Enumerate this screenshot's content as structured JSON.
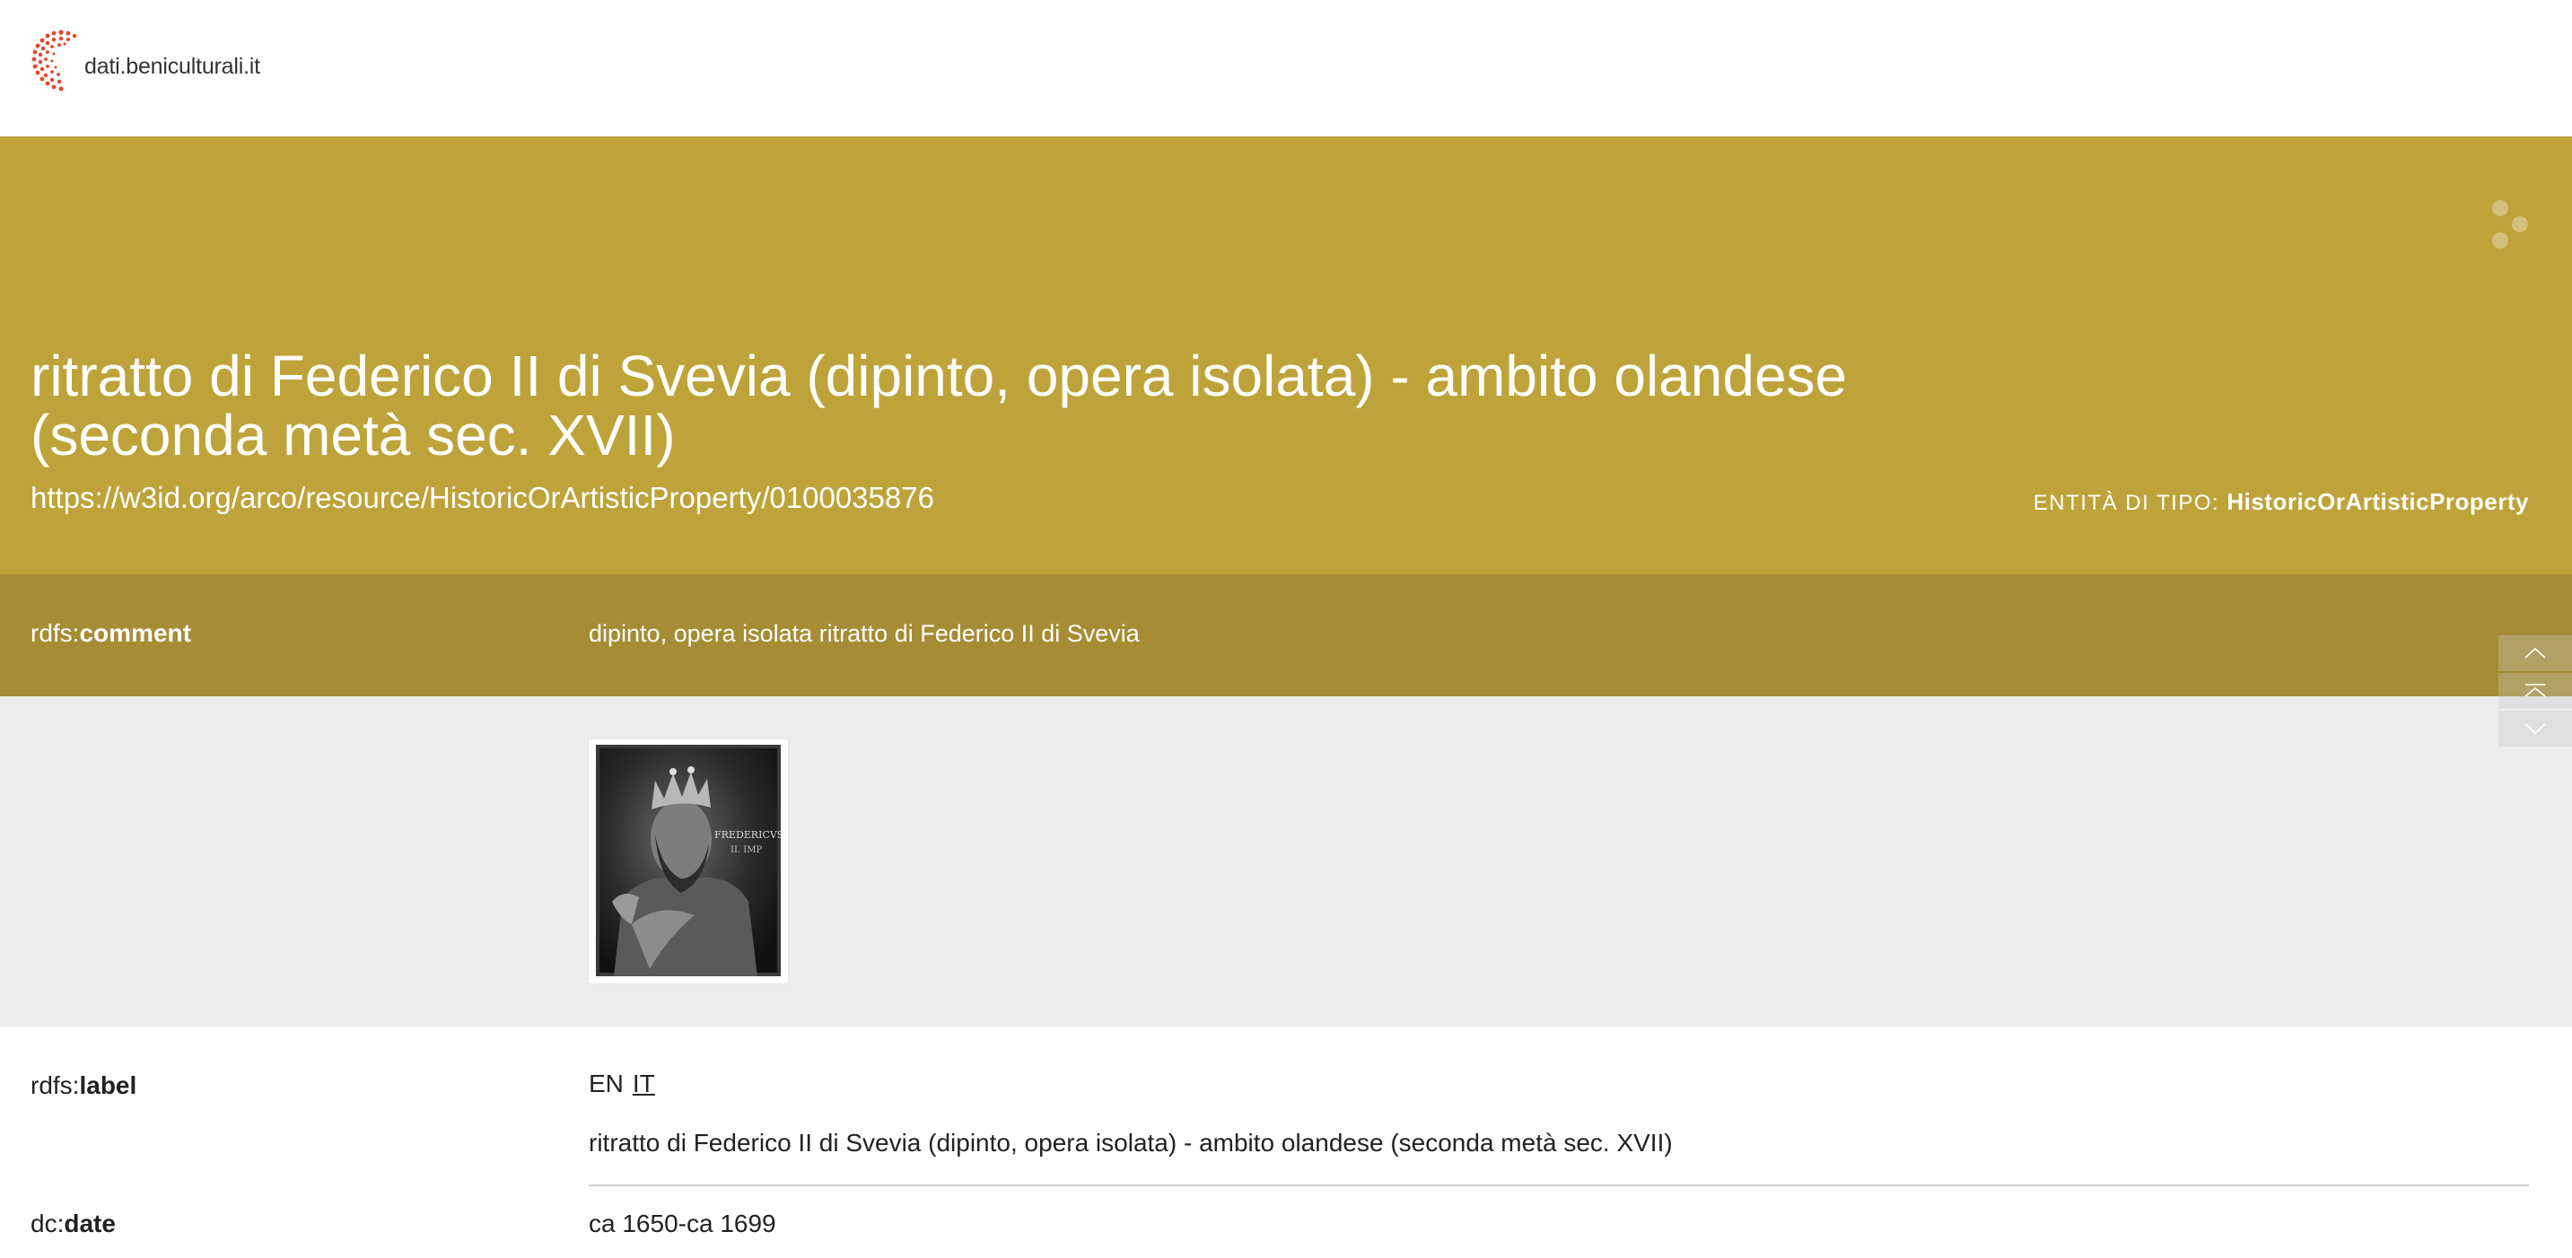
{
  "header": {
    "logo_text": "dati.beniculturali.it"
  },
  "hero": {
    "title": "ritratto di Federico II di Svevia (dipinto, opera isolata) - ambito olandese (seconda metà sec. XVII)",
    "uri": "https://w3id.org/arco/resource/HistoricOrArtisticProperty/0100035876",
    "type_prefix": "Entità di tipo:",
    "type_value": "HistoricOrArtisticProperty"
  },
  "comment": {
    "prefix": "rdfs:",
    "name": "comment",
    "value": "dipinto, opera isolata ritratto di Federico II di Svevia"
  },
  "image": {
    "inscription_line1": "FREDERICVS",
    "inscription_line2": "II. IMP"
  },
  "label": {
    "prefix": "rdfs:",
    "name": "label",
    "lang_en": "EN",
    "lang_it": "IT",
    "value": "ritratto di Federico II di Svevia (dipinto, opera isolata) - ambito olandese (seconda metà sec. XVII)"
  },
  "date": {
    "prefix": "dc:",
    "name": "date",
    "value": "ca 1650-ca 1699"
  },
  "colors": {
    "hero": "#bea33a",
    "comment_band": "#a68c34",
    "image_band": "#ececec",
    "logo_accent": "#e4442b"
  },
  "icons": {
    "side_nav": [
      "chevron-up-icon",
      "double-chevron-up-icon",
      "chevron-down-icon"
    ]
  }
}
